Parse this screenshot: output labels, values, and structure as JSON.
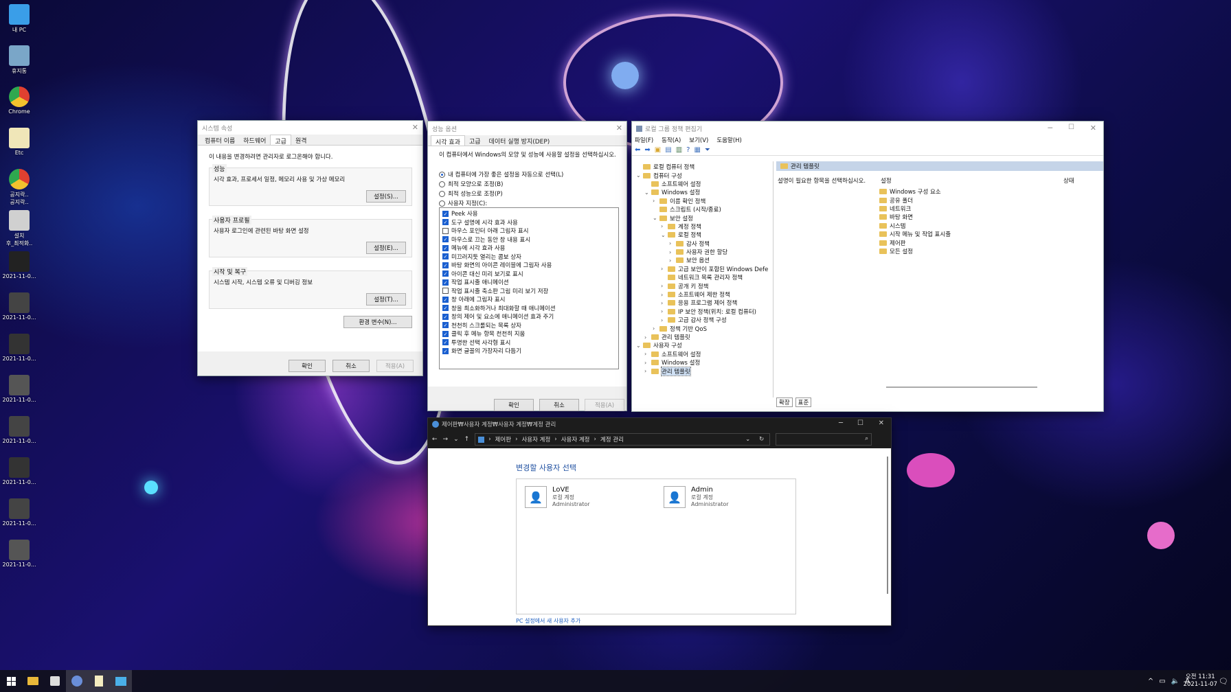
{
  "desktop": {
    "icons": [
      {
        "label": "내 PC",
        "icon": "monitor-icon",
        "color": "#3a9ee8"
      },
      {
        "label": "휴지통",
        "icon": "recycle-bin-icon",
        "color": "#7aa6c8"
      },
      {
        "label": "Chrome",
        "icon": "chrome-icon",
        "color": "#e04030"
      },
      {
        "label": "Etc",
        "icon": "document-icon",
        "color": "#f0e6b8"
      },
      {
        "label": "공지락..\n공지락..",
        "icon": "chrome-icon",
        "color": "#e04030"
      },
      {
        "label": "설치\n후_최적화..",
        "icon": "settings-icon",
        "color": "#d0d0d0"
      },
      {
        "label": "2021-11-0...",
        "icon": "screenshot-icon",
        "color": "#222"
      },
      {
        "label": "2021-11-0...",
        "icon": "screenshot-icon",
        "color": "#444"
      },
      {
        "label": "2021-11-0...",
        "icon": "screenshot-icon",
        "color": "#333"
      },
      {
        "label": "2021-11-0...",
        "icon": "screenshot-icon",
        "color": "#555"
      },
      {
        "label": "2021-11-0...",
        "icon": "screenshot-icon",
        "color": "#444"
      },
      {
        "label": "2021-11-0...",
        "icon": "screenshot-icon",
        "color": "#333"
      },
      {
        "label": "2021-11-0...",
        "icon": "screenshot-icon",
        "color": "#444"
      },
      {
        "label": "2021-11-0...",
        "icon": "screenshot-icon",
        "color": "#555"
      }
    ]
  },
  "sysprops": {
    "title": "시스템 속성",
    "tabs": [
      "컴퓨터 이름",
      "하드웨어",
      "고급",
      "원격"
    ],
    "notice": "이 내용을 변경하려면 관리자로 로그온해야 합니다.",
    "perf_title": "성능",
    "perf_desc": "시각 효과, 프로세서 일정, 메모리 사용 및 가상 메모리",
    "perf_btn": "설정(S)...",
    "profile_title": "사용자 프로필",
    "profile_desc": "사용자 로그인에 관련된 바탕 화면 설정",
    "profile_btn": "설정(E)...",
    "startup_title": "시작 및 복구",
    "startup_desc": "시스템 시작, 시스템 오류 및 디버깅 정보",
    "startup_btn": "설정(T)...",
    "env_btn": "환경 변수(N)...",
    "ok": "확인",
    "cancel": "취소",
    "apply": "적용(A)"
  },
  "perfopts": {
    "title": "성능 옵션",
    "tabs": [
      "시각 효과",
      "고급",
      "데이터 실행 방지(DEP)"
    ],
    "desc": "이 컴퓨터에서 Windows의 모양 및 성능에 사용할 설정을 선택하십시오.",
    "radios": [
      {
        "label": "내 컴퓨터에 가장 좋은 설정을 자동으로 선택(L)",
        "on": true
      },
      {
        "label": "최적 모양으로 조정(B)",
        "on": false
      },
      {
        "label": "최적 성능으로 조정(P)",
        "on": false
      },
      {
        "label": "사용자 지정(C):",
        "on": false
      }
    ],
    "checks": [
      {
        "label": "Peek 사용",
        "on": true
      },
      {
        "label": "도구 설명에 시각 효과 사용",
        "on": true
      },
      {
        "label": "마우스 포인터 아래 그림자 표시",
        "on": false
      },
      {
        "label": "마우스로 끄는 동안 창 내용 표시",
        "on": true
      },
      {
        "label": "메뉴에 시각 효과 사용",
        "on": true
      },
      {
        "label": "미끄러지듯 열리는 콤보 상자",
        "on": true
      },
      {
        "label": "바탕 화면의 아이콘 레이블에 그림자 사용",
        "on": true
      },
      {
        "label": "아이콘 대신 미리 보기로 표시",
        "on": true
      },
      {
        "label": "작업 표시줄 애니메이션",
        "on": true
      },
      {
        "label": "작업 표시줄 축소판 그림 미리 보기 저장",
        "on": false
      },
      {
        "label": "창 아래에 그림자 표시",
        "on": true
      },
      {
        "label": "창을 최소화하거나 최대화할 때 애니메이션",
        "on": true
      },
      {
        "label": "창의 제어 및 요소에 애니메이션 효과 주기",
        "on": true
      },
      {
        "label": "천천히 스크롤되는 목록 상자",
        "on": true
      },
      {
        "label": "클릭 후 메뉴 항목 천천히 지움",
        "on": true
      },
      {
        "label": "투명한 선택 사각형 표시",
        "on": true
      },
      {
        "label": "화면 글꼴의 가장자리 다듬기",
        "on": true
      }
    ],
    "ok": "확인",
    "cancel": "취소",
    "apply": "적용(A)"
  },
  "gpedit": {
    "title": "로컬 그룹 정책 편집기",
    "menu": [
      "파일(F)",
      "동작(A)",
      "보기(V)",
      "도움말(H)"
    ],
    "tree": [
      {
        "label": "로컬 컴퓨터 정책",
        "depth": 0,
        "exp": "",
        "sel": false
      },
      {
        "label": "컴퓨터 구성",
        "depth": 0,
        "exp": "v",
        "sel": false
      },
      {
        "label": "소프트웨어 설정",
        "depth": 1,
        "exp": "",
        "sel": false
      },
      {
        "label": "Windows 설정",
        "depth": 1,
        "exp": "v",
        "sel": false
      },
      {
        "label": "이름 확인 정책",
        "depth": 2,
        "exp": ">",
        "sel": false
      },
      {
        "label": "스크립트 (시작/종료)",
        "depth": 2,
        "exp": "",
        "sel": false
      },
      {
        "label": "보안 설정",
        "depth": 2,
        "exp": "v",
        "sel": false
      },
      {
        "label": "계정 정책",
        "depth": 3,
        "exp": ">",
        "sel": false
      },
      {
        "label": "로컬 정책",
        "depth": 3,
        "exp": "v",
        "sel": false
      },
      {
        "label": "감사 정책",
        "depth": 4,
        "exp": ">",
        "sel": false
      },
      {
        "label": "사용자 권한 할당",
        "depth": 4,
        "exp": ">",
        "sel": false
      },
      {
        "label": "보안 옵션",
        "depth": 4,
        "exp": ">",
        "sel": false
      },
      {
        "label": "고급 보안이 포함된 Windows Defe",
        "depth": 3,
        "exp": ">",
        "sel": false
      },
      {
        "label": "네트워크 목록 관리자 정책",
        "depth": 3,
        "exp": "",
        "sel": false
      },
      {
        "label": "공개 키 정책",
        "depth": 3,
        "exp": ">",
        "sel": false
      },
      {
        "label": "소프트웨어 제한 정책",
        "depth": 3,
        "exp": ">",
        "sel": false
      },
      {
        "label": "응용 프로그램 제어 정책",
        "depth": 3,
        "exp": ">",
        "sel": false
      },
      {
        "label": "IP 보안 정책(위치: 로컬 컴퓨터)",
        "depth": 3,
        "exp": ">",
        "sel": false
      },
      {
        "label": "고급 감사 정책 구성",
        "depth": 3,
        "exp": ">",
        "sel": false
      },
      {
        "label": "정책 기반 QoS",
        "depth": 2,
        "exp": ">",
        "sel": false
      },
      {
        "label": "관리 템플릿",
        "depth": 1,
        "exp": ">",
        "sel": false
      },
      {
        "label": "사용자 구성",
        "depth": 0,
        "exp": "v",
        "sel": false
      },
      {
        "label": "소프트웨어 설정",
        "depth": 1,
        "exp": ">",
        "sel": false
      },
      {
        "label": "Windows 설정",
        "depth": 1,
        "exp": ">",
        "sel": false
      },
      {
        "label": "관리 템플릿",
        "depth": 1,
        "exp": ">",
        "sel": true
      }
    ],
    "header": "관리 템플릿",
    "hint": "설명이 필요한 항목을 선택하십시오.",
    "col_setting": "설정",
    "col_state": "상태",
    "items": [
      "Windows 구성 요소",
      "공유 폴더",
      "네트워크",
      "바탕 화면",
      "시스템",
      "시작 메뉴 및 작업 표시줄",
      "제어판",
      "모든 설정"
    ],
    "bottom_tabs": [
      "확장",
      "표준"
    ]
  },
  "useracct": {
    "title": "제어판₩사용자 계정₩사용자 계정₩계정 관리",
    "crumbs": [
      "제어판",
      "사용자 계정",
      "사용자 계정",
      "계정 관리"
    ],
    "heading": "변경할 사용자 선택",
    "users": [
      {
        "name": "LoVE",
        "type": "로컬 계정",
        "role": "Administrator"
      },
      {
        "name": "Admin",
        "type": "로컬 계정",
        "role": "Administrator"
      }
    ],
    "add_link": "PC 설정에서 새 사용자 추가"
  },
  "taskbar": {
    "time": "오전 11:31",
    "date": "2021-11-07",
    "ime": "A"
  }
}
